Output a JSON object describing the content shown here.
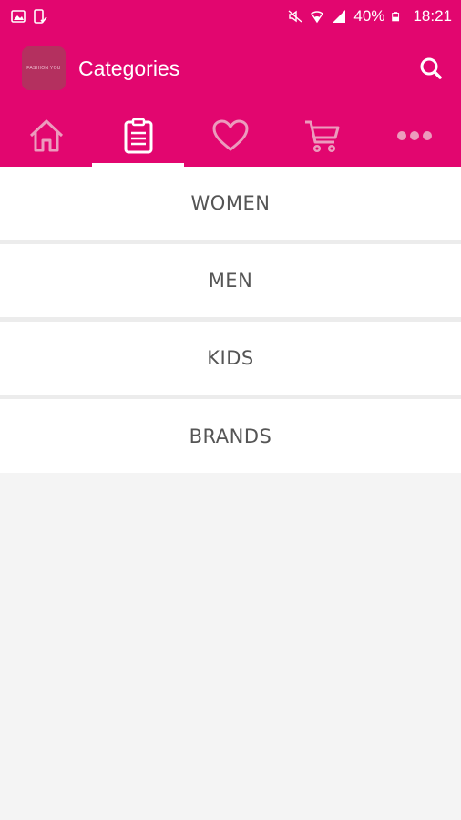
{
  "status_bar": {
    "battery": "40%",
    "time": "18:21"
  },
  "toolbar": {
    "logo_text": "FASHION YOU",
    "title": "Categories"
  },
  "tabs": [
    {
      "icon": "home-icon",
      "active": false
    },
    {
      "icon": "clipboard-icon",
      "active": true
    },
    {
      "icon": "heart-icon",
      "active": false
    },
    {
      "icon": "cart-icon",
      "active": false
    },
    {
      "icon": "more-icon",
      "active": false
    }
  ],
  "categories": [
    "WOMEN",
    "MEN",
    "KIDS",
    "BRANDS"
  ],
  "colors": {
    "brand": "#e2066f",
    "background": "#f4f4f4",
    "item_text": "#555555"
  }
}
